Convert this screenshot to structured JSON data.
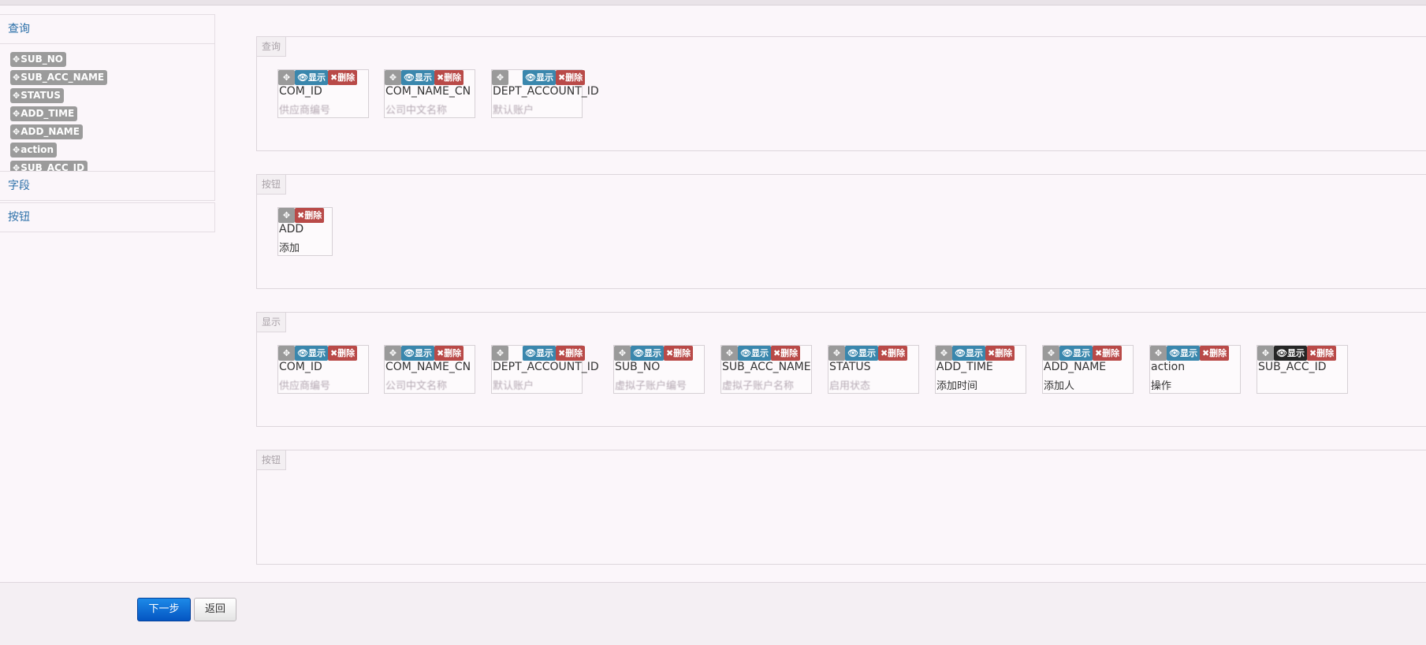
{
  "sidebar": {
    "query_heading": "查询",
    "fields": [
      "SUB_NO",
      "SUB_ACC_NAME",
      "STATUS",
      "ADD_TIME",
      "ADD_NAME",
      "action",
      "SUB_ACC_ID"
    ],
    "fields_heading": "字段",
    "buttons_heading": "按钮"
  },
  "card_actions": {
    "move_glyph": "✥",
    "show": "👁显示",
    "delete": "✖删除"
  },
  "panels": {
    "query": {
      "legend": "查询",
      "cards": [
        {
          "name": "COM_ID",
          "label": "供应商编号"
        },
        {
          "name": "COM_NAME_CN",
          "label": "公司中文名称"
        },
        {
          "name": "DEPT_ACCOUNT_ID",
          "label": "默认账户"
        }
      ]
    },
    "buttons": {
      "legend": "按钮",
      "cards": [
        {
          "name": "ADD",
          "label": "添加"
        }
      ]
    },
    "display": {
      "legend": "显示",
      "cards": [
        {
          "name": "COM_ID",
          "label": "供应商编号"
        },
        {
          "name": "COM_NAME_CN",
          "label": "公司中文名称"
        },
        {
          "name": "DEPT_ACCOUNT_ID",
          "label": "默认账户"
        },
        {
          "name": "SUB_NO",
          "label": "虚拟子账户编号"
        },
        {
          "name": "SUB_ACC_NAME",
          "label": "虚拟子账户名称"
        },
        {
          "name": "STATUS",
          "label": "启用状态"
        },
        {
          "name": "ADD_TIME",
          "label": "添加时间"
        },
        {
          "name": "ADD_NAME",
          "label": "添加人"
        },
        {
          "name": "action",
          "label": "操作"
        },
        {
          "name": "SUB_ACC_ID",
          "label": ""
        }
      ]
    },
    "buttons2": {
      "legend": "按钮"
    }
  },
  "footer": {
    "next_label": "下一步",
    "back_label": "返回"
  }
}
